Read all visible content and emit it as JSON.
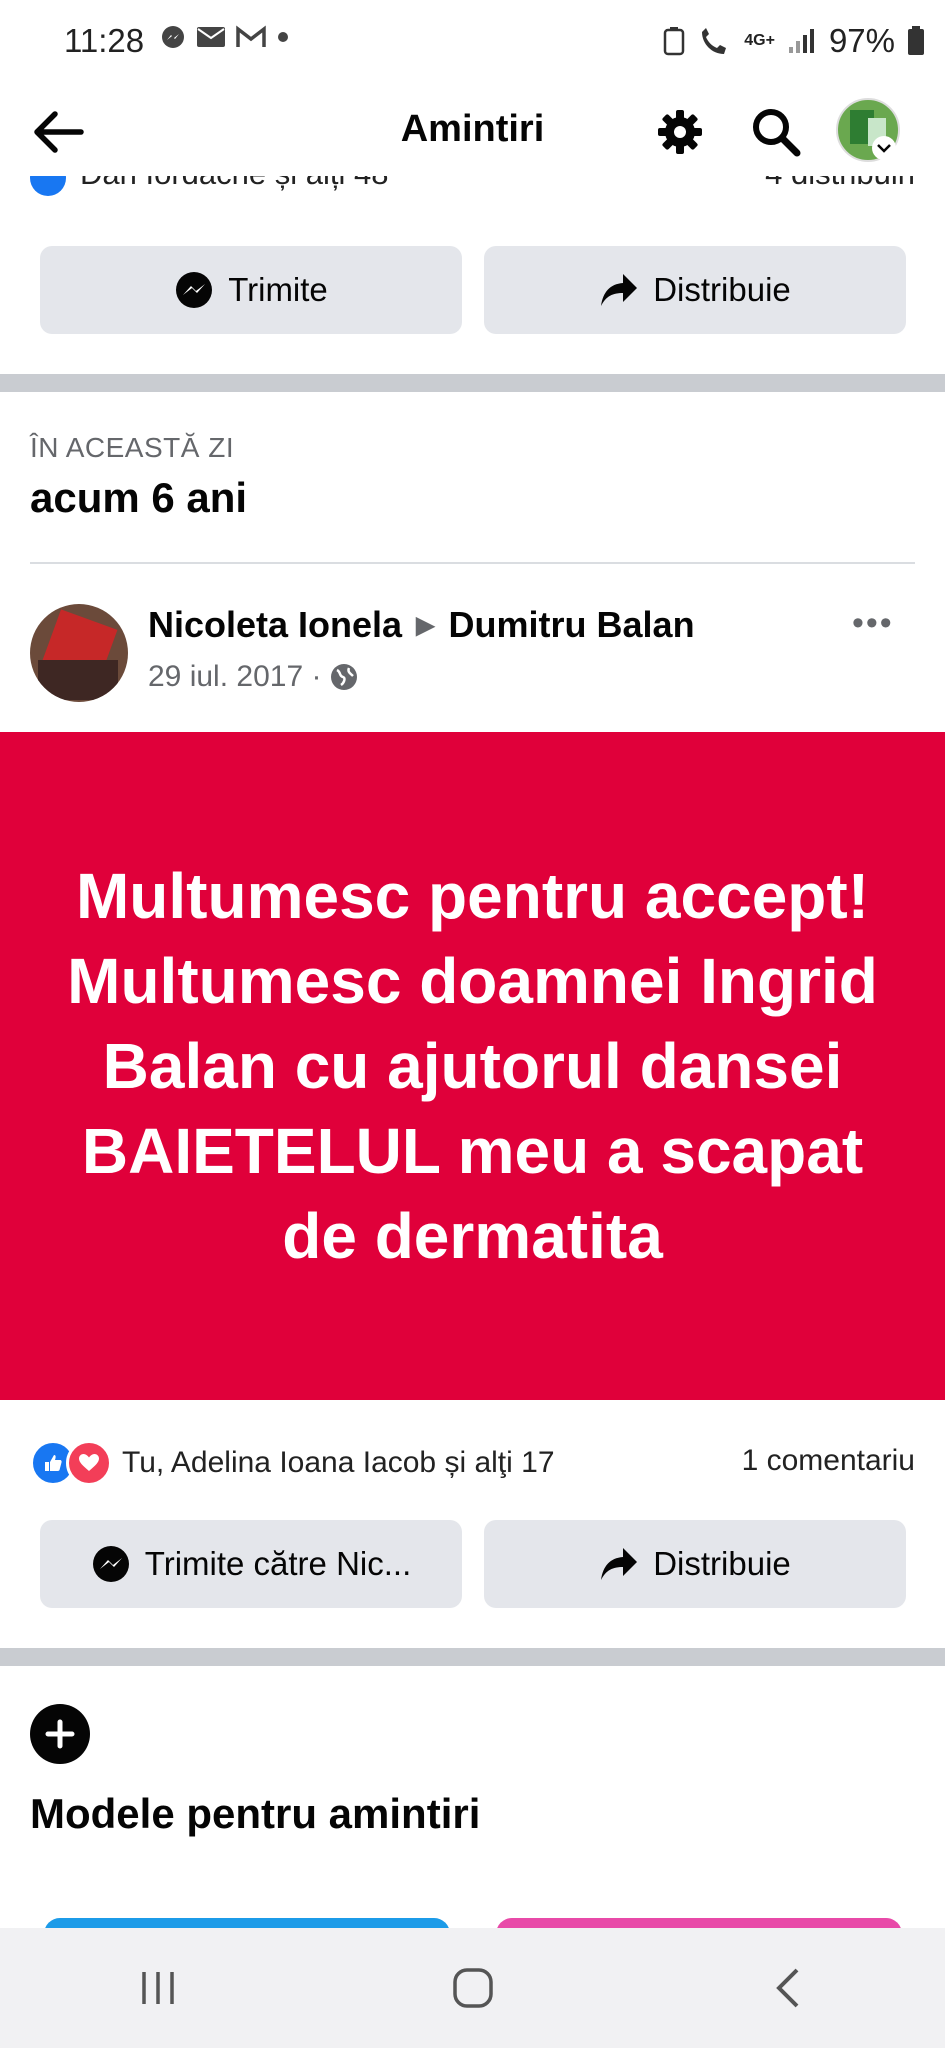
{
  "status_bar": {
    "time": "11:28",
    "network": "4G+",
    "battery": "97%"
  },
  "header": {
    "title": "Amintiri"
  },
  "prev_post": {
    "reactions_partial": "Dan Iordache și alți 48",
    "shares_partial": "4 distribuiri",
    "send_label": "Trimite",
    "share_label": "Distribuie"
  },
  "memory": {
    "section_label": "ÎN ACEASTĂ ZI",
    "age_heading": "acum 6 ani"
  },
  "post": {
    "author": "Nicoleta Ionela",
    "arrow": "▶",
    "recipient": "Dumitru Balan",
    "date": "29 iul. 2017 ·",
    "more": "•••",
    "message": "Multumesc pentru accept!  Multumesc doamnei Ingrid Balan cu ajutorul dansei BAIETELUL meu a scapat de dermatita",
    "reactions_text": "Tu, Adelina Ioana Iacob și alţi 17",
    "comments_text": "1 comentariu",
    "send_to_label": "Trimite către Nic...",
    "share_label": "Distribuie"
  },
  "templates": {
    "title": "Modele pentru amintiri"
  },
  "colors": {
    "banner": "#e0003a",
    "like": "#1877f2",
    "love": "#f33e58",
    "card_blue": "#1c9be8",
    "card_pink": "#e84aa8"
  }
}
